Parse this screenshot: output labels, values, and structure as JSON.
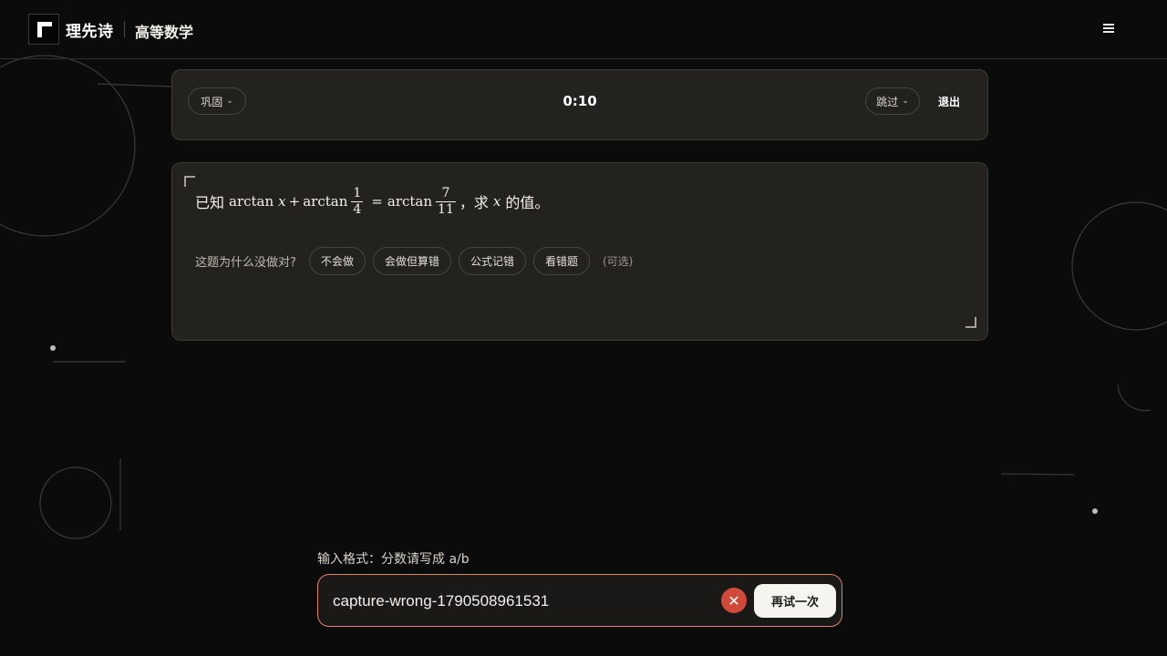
{
  "header": {
    "brand": "理先诗",
    "subject": "高等数学",
    "menu_icon": "menu-icon"
  },
  "controls": {
    "mode_label": "巩固",
    "timer": "0:10",
    "skip_label": "跳过",
    "exit_label": "退出"
  },
  "question": {
    "prefix": "已知",
    "func": "arctan",
    "var": "x",
    "plus": "+",
    "eq": "=",
    "frac1_num": "1",
    "frac1_den": "4",
    "frac2_num": "7",
    "frac2_den": "11",
    "comma": "，",
    "ask": "求",
    "suffix": "的值。"
  },
  "feedback": {
    "label": "这题为什么没做对?",
    "reasons": [
      "不会做",
      "会做但算错",
      "公式记错",
      "看错题"
    ],
    "optional": "(可选)"
  },
  "answer": {
    "format_hint": "输入格式：分数请写成 a/b",
    "value": "capture-wrong-1790508961531",
    "clear_icon": "close-icon",
    "clear_symbol": "✕",
    "retry_label": "再试一次"
  },
  "colors": {
    "background": "#0b0b0b",
    "panel": "#23221f",
    "accent_border": "#e0826c",
    "clear_red": "#d1493a"
  }
}
